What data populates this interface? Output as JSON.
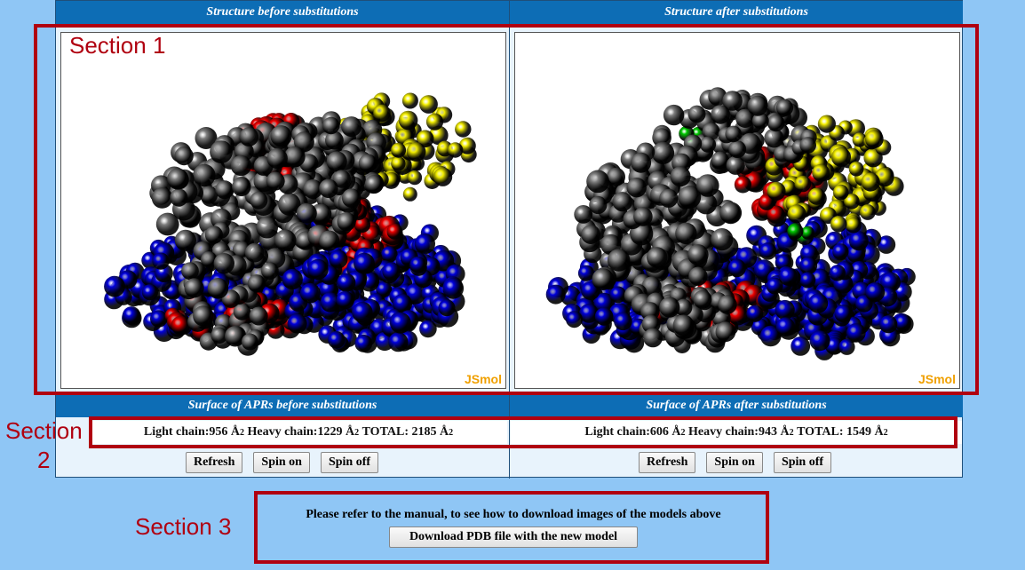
{
  "headers": {
    "before": "Structure before substitutions",
    "after": "Structure after substitutions",
    "surface_before": "Surface of APRs before substitutions",
    "surface_after": "Surface of APRs after substitutions"
  },
  "viewer_brand": "JSmol",
  "surface": {
    "before": {
      "light_label": "Light chain:",
      "light_value": "956",
      "heavy_label": "Heavy chain:",
      "heavy_value": "1229",
      "total_label": "TOTAL:",
      "total_value": "2185",
      "unit": "Å",
      "exp": "2"
    },
    "after": {
      "light_label": "Light chain:",
      "light_value": "606",
      "heavy_label": "Heavy chain:",
      "heavy_value": "943",
      "total_label": "TOTAL:",
      "total_value": "1549",
      "unit": "Å",
      "exp": "2"
    }
  },
  "buttons": {
    "refresh": "Refresh",
    "spin_on": "Spin on",
    "spin_off": "Spin off"
  },
  "download_note": "Please refer to the manual, to see how to download images of the models above",
  "download_button": "Download PDB file with the new model",
  "annotations": {
    "section1": "Section 1",
    "section2_a": "Section",
    "section2_b": "2",
    "section3": "Section 3"
  },
  "colors": {
    "chain_gray": "#808080",
    "chain_blue": "#0000dd",
    "chain_red": "#ee0000",
    "chain_yellow": "#f5f000",
    "chain_green": "#00cc00",
    "header_blue": "#0d6db5",
    "annotation_red": "#b00010"
  }
}
